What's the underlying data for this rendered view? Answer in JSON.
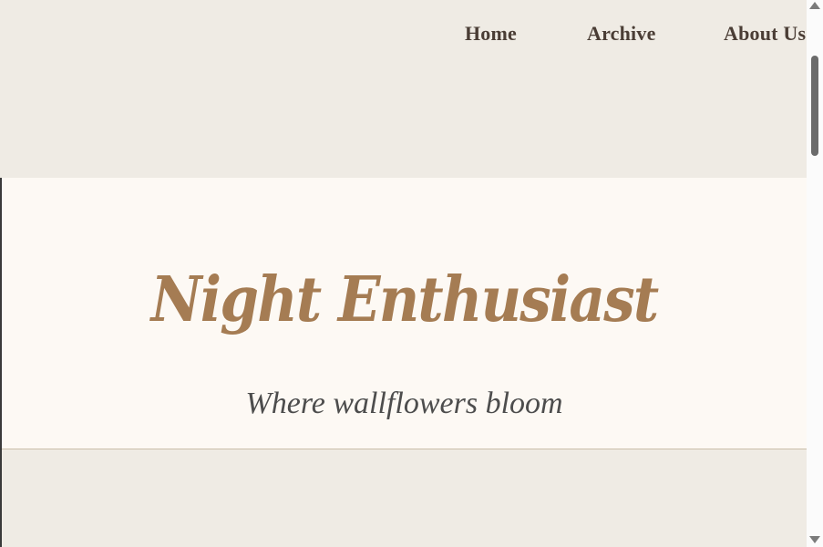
{
  "navigation": {
    "items": [
      {
        "label": "Home"
      },
      {
        "label": "Archive"
      },
      {
        "label": "About Us"
      }
    ]
  },
  "hero": {
    "title": "Night Enthusiast",
    "tagline": "Where wallflowers bloom"
  },
  "colors": {
    "background": "#efebe4",
    "hero_background": "#fdf9f4",
    "title": "#a57c53",
    "navigation_text": "#4a3d35",
    "tagline_text": "#4d4d4d"
  },
  "icons": {
    "scroll_up": "up-arrow-icon",
    "scroll_down": "down-arrow-icon"
  }
}
